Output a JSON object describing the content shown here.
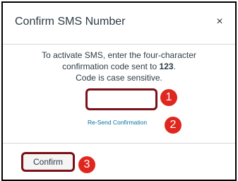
{
  "dialog": {
    "title": "Confirm SMS Number",
    "close_glyph": "×",
    "instructions_line1": "To activate SMS, enter the four-character",
    "instructions_line2_pre": "confirmation code sent to ",
    "instructions_number": "123",
    "instructions_line2_post": ".",
    "instructions_line3": "Code is case sensitive.",
    "code_input_value": "",
    "resend_label": "Re-Send Confirmation",
    "confirm_label": "Confirm"
  },
  "annotations": {
    "badge1": "1",
    "badge2": "2",
    "badge3": "3"
  },
  "colors": {
    "highlight_outline": "#7a1018",
    "badge": "#e0271f",
    "link": "#0770a3",
    "text": "#2d3b45"
  },
  "icons": {
    "close": "close-icon"
  }
}
